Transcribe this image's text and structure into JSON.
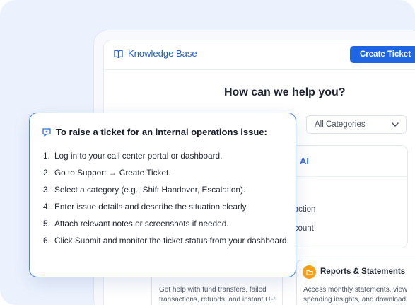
{
  "app": {
    "logo_label": "Knowledge Base",
    "create_ticket_label": "Create Ticket",
    "accent_color": "#1f66e5"
  },
  "search": {
    "heading": "How can we help you?",
    "category_selected": "All Categories"
  },
  "ai_panel": {
    "label": "AI",
    "line1": "saction",
    "line2": "ccount"
  },
  "cards": [
    {
      "title": "",
      "description": "Get help with fund transfers, failed transactions, refunds, and instant UPI",
      "icon": "transfer-icon",
      "icon_color": "#2e7d9a"
    },
    {
      "title": "Reports & Statements",
      "description": "Access monthly statements, view spending insights, and download",
      "icon": "folder-icon",
      "icon_color": "#f6a21a"
    }
  ],
  "popup": {
    "title": "To raise a ticket for an internal operations issue:",
    "icon": "sparkle-chat-icon",
    "steps": [
      {
        "num": "1.",
        "text": "Log in to your call center portal or dashboard."
      },
      {
        "num": "2.",
        "text": "Go to Support → Create Ticket."
      },
      {
        "num": "3.",
        "text": "Select a category (e.g., Shift Handover, Escalation)."
      },
      {
        "num": "4.",
        "text": "Enter issue details and describe the situation clearly."
      },
      {
        "num": "5.",
        "text": "Attach relevant notes or screenshots if needed."
      },
      {
        "num": "6.",
        "text": "Click Submit and monitor the ticket status from your dashboard."
      }
    ]
  }
}
